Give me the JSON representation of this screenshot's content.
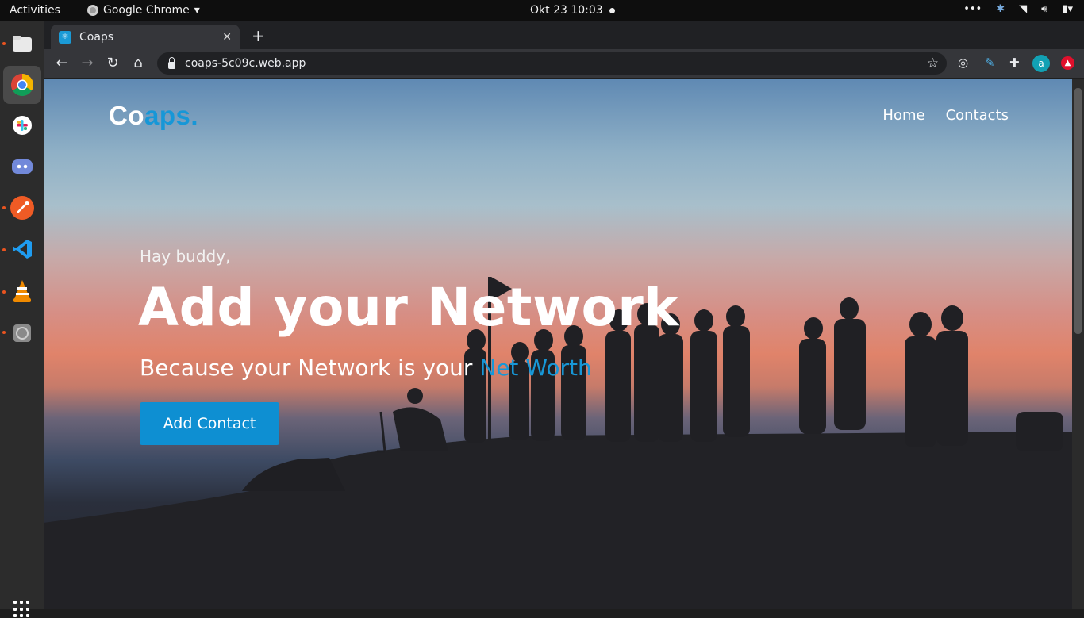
{
  "system_bar": {
    "activities": "Activities",
    "app_name": "Google Chrome",
    "clock": "Okt 23  10:03"
  },
  "browser": {
    "tab_title": "Coaps",
    "url": "coaps-5c09c.web.app",
    "profile_initial": "a"
  },
  "page": {
    "brand_main": "Co",
    "brand_accent": "aps.",
    "nav": [
      "Home",
      "Contacts"
    ],
    "greeting": "Hay buddy,",
    "headline": "Add your Network",
    "subheading_main": "Because your Network is your ",
    "subheading_accent": "Net Worth",
    "cta_label": "Add Contact"
  },
  "colors": {
    "accent": "#1797d7",
    "button": "#0e8fd2"
  },
  "dock_icons": [
    "files-icon",
    "chrome-icon",
    "slack-icon",
    "discord-icon",
    "postman-icon",
    "vscode-icon",
    "vlc-icon",
    "disk-icon",
    "app-grid-icon"
  ]
}
